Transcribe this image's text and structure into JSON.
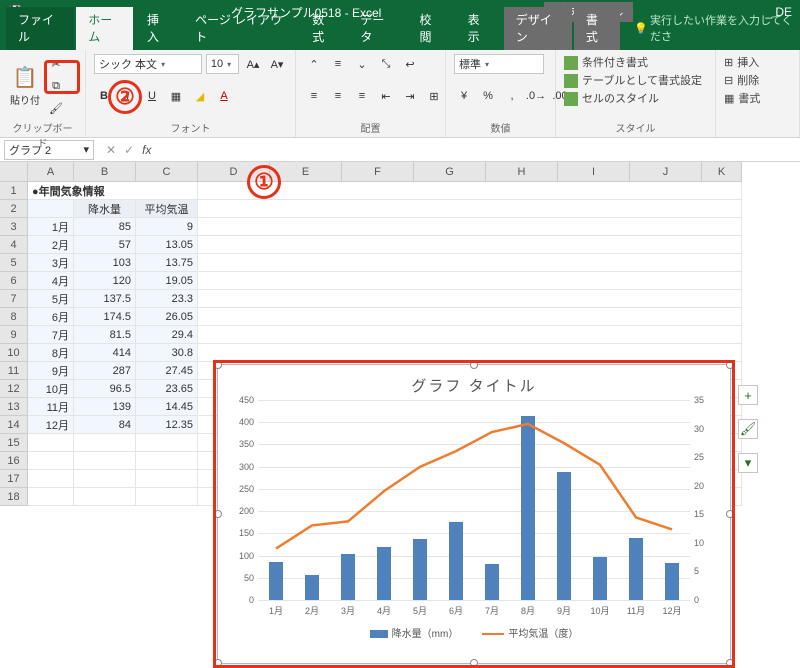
{
  "titlebar": {
    "doc_title": "グラフサンプル0518 - Excel",
    "tool_tab": "グラフ ツール",
    "right_text": "_ DE"
  },
  "tabs": {
    "file": "ファイル",
    "home": "ホーム",
    "insert": "挿入",
    "page_layout": "ページ レイアウト",
    "formulas": "数式",
    "data": "データ",
    "review": "校閲",
    "view": "表示",
    "design": "デザイン",
    "format": "書式",
    "tellme": "実行したい作業を入力してくださ"
  },
  "ribbon": {
    "clipboard": {
      "paste": "貼り付",
      "label": "クリップボード"
    },
    "font": {
      "name": "シック 本文",
      "size": "10",
      "label": "フォント"
    },
    "alignment": {
      "label": "配置"
    },
    "number": {
      "format": "標準",
      "label": "数値"
    },
    "styles": {
      "cond_format": "条件付き書式",
      "format_table": "テーブルとして書式設定",
      "cell_styles": "セルのスタイル",
      "label": "スタイル"
    },
    "cells": {
      "insert": "挿入",
      "delete": "削除",
      "format": "書式"
    }
  },
  "namebox": "グラフ 2",
  "annotations": {
    "one": "①",
    "two": "②"
  },
  "sheet": {
    "title_cell": "●年間気象情報",
    "headers": {
      "b": "降水量",
      "c": "平均気温"
    },
    "rows": [
      {
        "month": "1月",
        "rain": "85",
        "temp": "9"
      },
      {
        "month": "2月",
        "rain": "57",
        "temp": "13.05"
      },
      {
        "month": "3月",
        "rain": "103",
        "temp": "13.75"
      },
      {
        "month": "4月",
        "rain": "120",
        "temp": "19.05"
      },
      {
        "month": "5月",
        "rain": "137.5",
        "temp": "23.3"
      },
      {
        "month": "6月",
        "rain": "174.5",
        "temp": "26.05"
      },
      {
        "month": "7月",
        "rain": "81.5",
        "temp": "29.4"
      },
      {
        "month": "8月",
        "rain": "414",
        "temp": "30.8"
      },
      {
        "month": "9月",
        "rain": "287",
        "temp": "27.45"
      },
      {
        "month": "10月",
        "rain": "96.5",
        "temp": "23.65"
      },
      {
        "month": "11月",
        "rain": "139",
        "temp": "14.45"
      },
      {
        "month": "12月",
        "rain": "84",
        "temp": "12.35"
      }
    ]
  },
  "chart_data": {
    "type": "bar+line",
    "title": "グラフ タイトル",
    "categories": [
      "1月",
      "2月",
      "3月",
      "4月",
      "5月",
      "6月",
      "7月",
      "8月",
      "9月",
      "10月",
      "11月",
      "12月"
    ],
    "series": [
      {
        "name": "降水量（mm）",
        "type": "bar",
        "axis": "left",
        "values": [
          85,
          57,
          103,
          120,
          137.5,
          174.5,
          81.5,
          414,
          287,
          96.5,
          139,
          84
        ]
      },
      {
        "name": "平均気温（度）",
        "type": "line",
        "axis": "right",
        "values": [
          9,
          13.05,
          13.75,
          19.05,
          23.3,
          26.05,
          29.4,
          30.8,
          27.45,
          23.65,
          14.45,
          12.35
        ],
        "color": "#ed7d31"
      }
    ],
    "y_left": {
      "min": 0,
      "max": 450,
      "step": 50
    },
    "y_right": {
      "min": 0,
      "max": 35,
      "step": 5
    },
    "legend_labels": {
      "bar": "降水量（mm）",
      "line": "平均気温（度）"
    }
  }
}
